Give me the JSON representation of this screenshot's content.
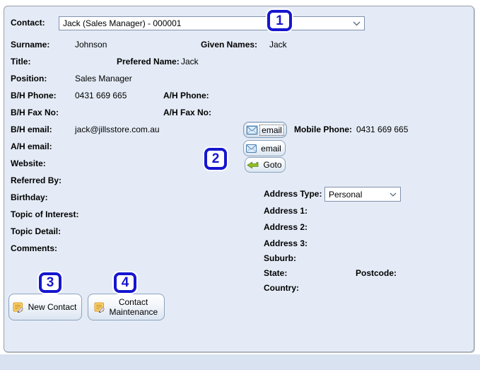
{
  "contact": {
    "label": "Contact:",
    "value": "Jack (Sales Manager) - 000001"
  },
  "fields": {
    "surname": {
      "label": "Surname:",
      "value": "Johnson"
    },
    "given_names": {
      "label": "Given Names:",
      "value": "Jack"
    },
    "title": {
      "label": "Title:",
      "value": ""
    },
    "prefered_name": {
      "label": "Prefered Name:",
      "value": "Jack"
    },
    "position": {
      "label": "Position:",
      "value": "Sales Manager"
    },
    "bh_phone": {
      "label": "B/H Phone:",
      "value": "0431 669 665"
    },
    "ah_phone": {
      "label": "A/H Phone:",
      "value": ""
    },
    "bh_fax": {
      "label": "B/H Fax No:",
      "value": ""
    },
    "ah_fax": {
      "label": "A/H Fax No:",
      "value": ""
    },
    "bh_email": {
      "label": "B/H email:",
      "value": "jack@jillsstore.com.au"
    },
    "mobile_phone": {
      "label": "Mobile Phone:",
      "value": "0431 669 665"
    },
    "ah_email": {
      "label": "A/H email:",
      "value": ""
    },
    "website": {
      "label": "Website:",
      "value": ""
    },
    "referred_by": {
      "label": "Referred By:",
      "value": ""
    },
    "birthday": {
      "label": "Birthday:",
      "value": ""
    },
    "topic_of_interest": {
      "label": "Topic of Interest:",
      "value": ""
    },
    "topic_detail": {
      "label": "Topic Detail:",
      "value": ""
    },
    "comments": {
      "label": "Comments:",
      "value": ""
    }
  },
  "address": {
    "type": {
      "label": "Address Type:",
      "value": "Personal"
    },
    "line1": {
      "label": "Address 1:",
      "value": ""
    },
    "line2": {
      "label": "Address 2:",
      "value": ""
    },
    "line3": {
      "label": "Address 3:",
      "value": ""
    },
    "suburb": {
      "label": "Suburb:",
      "value": ""
    },
    "state": {
      "label": "State:",
      "value": ""
    },
    "postcode": {
      "label": "Postcode:",
      "value": ""
    },
    "country": {
      "label": "Country:",
      "value": ""
    }
  },
  "buttons": {
    "bh_email": "email",
    "ah_email": "email",
    "goto": "Goto",
    "new_contact": "New Contact",
    "contact_maintenance": "Contact Maintenance"
  },
  "annotations": {
    "n1": "1",
    "n2": "2",
    "n3": "3",
    "n4": "4"
  },
  "colors": {
    "annotation_blue": "#1616cf",
    "panel_background": "#e4ebf6",
    "button_border": "#8ba3bd"
  }
}
